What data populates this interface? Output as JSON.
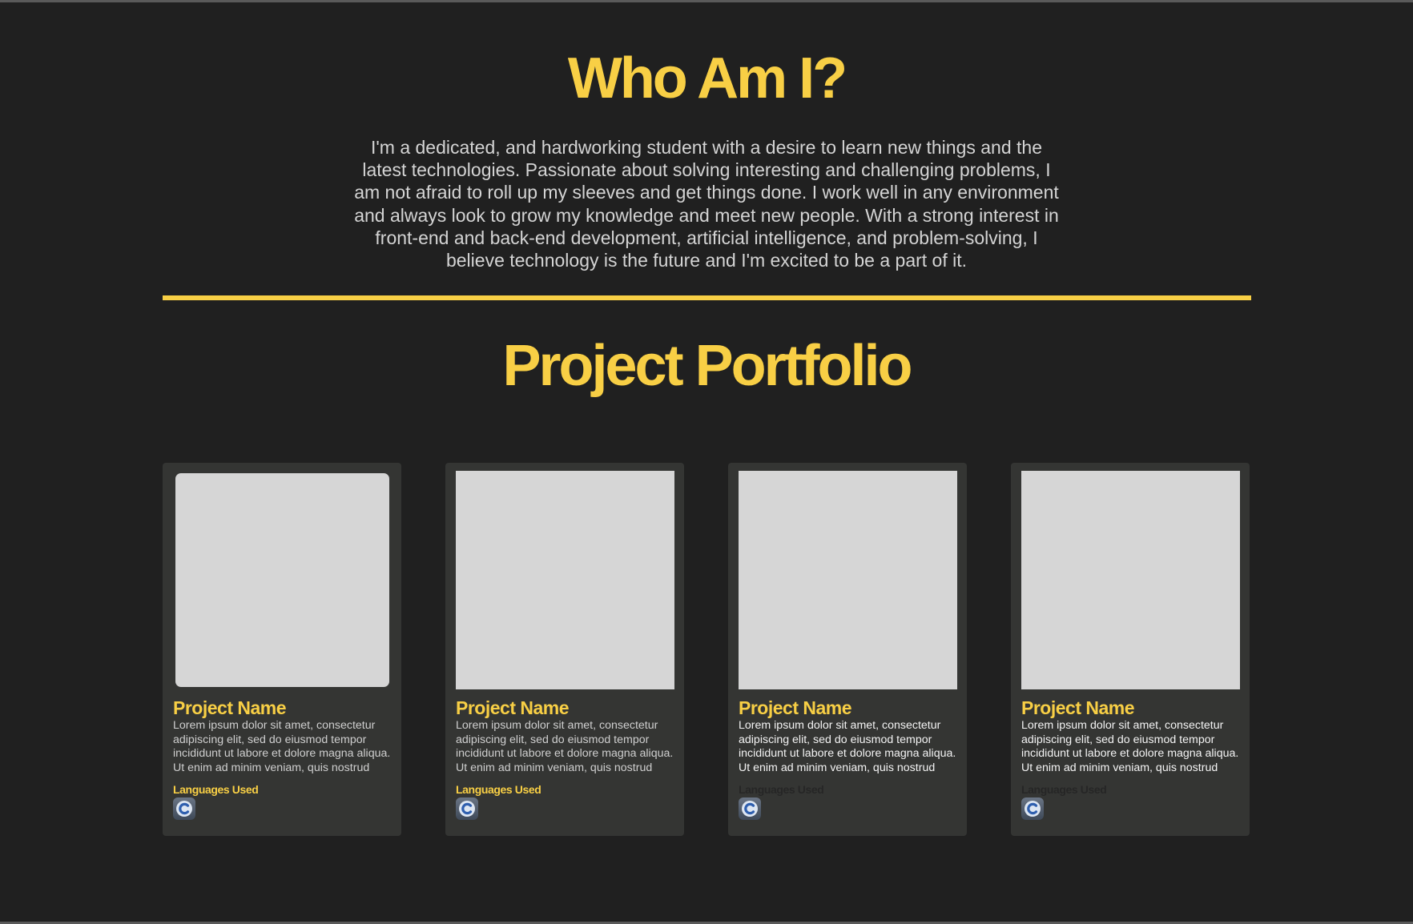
{
  "about": {
    "title": "Who Am I?",
    "text": "I'm a dedicated, and hardworking student with a desire to learn new things and the latest technologies. Passionate about solving interesting and challenging problems, I am not afraid to roll up my sleeves and get things done. I work well in any environment and always look to grow my knowledge and meet new people. With a strong interest in front-end and back-end development, artificial intelligence, and problem-solving, I believe technology is the future and I'm excited to be a part of it."
  },
  "portfolio": {
    "title": "Project Portfolio",
    "projects": [
      {
        "name": "Project Name",
        "description": "Lorem ipsum dolor sit amet, consectetur adipiscing elit, sed do eiusmod tempor incididunt ut labore et dolore magna aliqua. Ut enim ad minim veniam, quis nostrud",
        "languages_label": "Languages Used",
        "language_icon": "c-language-icon"
      },
      {
        "name": "Project Name",
        "description": "Lorem ipsum dolor sit amet, consectetur adipiscing elit, sed do eiusmod tempor incididunt ut labore et dolore magna aliqua. Ut enim ad minim veniam, quis nostrud",
        "languages_label": "Languages Used",
        "language_icon": "c-language-icon"
      },
      {
        "name": "Project Name",
        "description": "Lorem ipsum dolor sit amet, consectetur adipiscing elit, sed do eiusmod tempor incididunt ut labore et dolore magna aliqua. Ut enim ad minim veniam, quis nostrud",
        "languages_label": "Languages Used",
        "language_icon": "c-language-icon"
      },
      {
        "name": "Project Name",
        "description": "Lorem ipsum dolor sit amet, consectetur adipiscing elit, sed do eiusmod tempor incididunt ut labore et dolore magna aliqua. Ut enim ad minim veniam, quis nostrud",
        "languages_label": "Languages Used",
        "language_icon": "c-language-icon"
      }
    ]
  },
  "colors": {
    "background": "#202020",
    "accent": "#f8cf45",
    "card": "#343533",
    "placeholder": "#d6d6d6",
    "body_text": "#d4d4d4"
  }
}
